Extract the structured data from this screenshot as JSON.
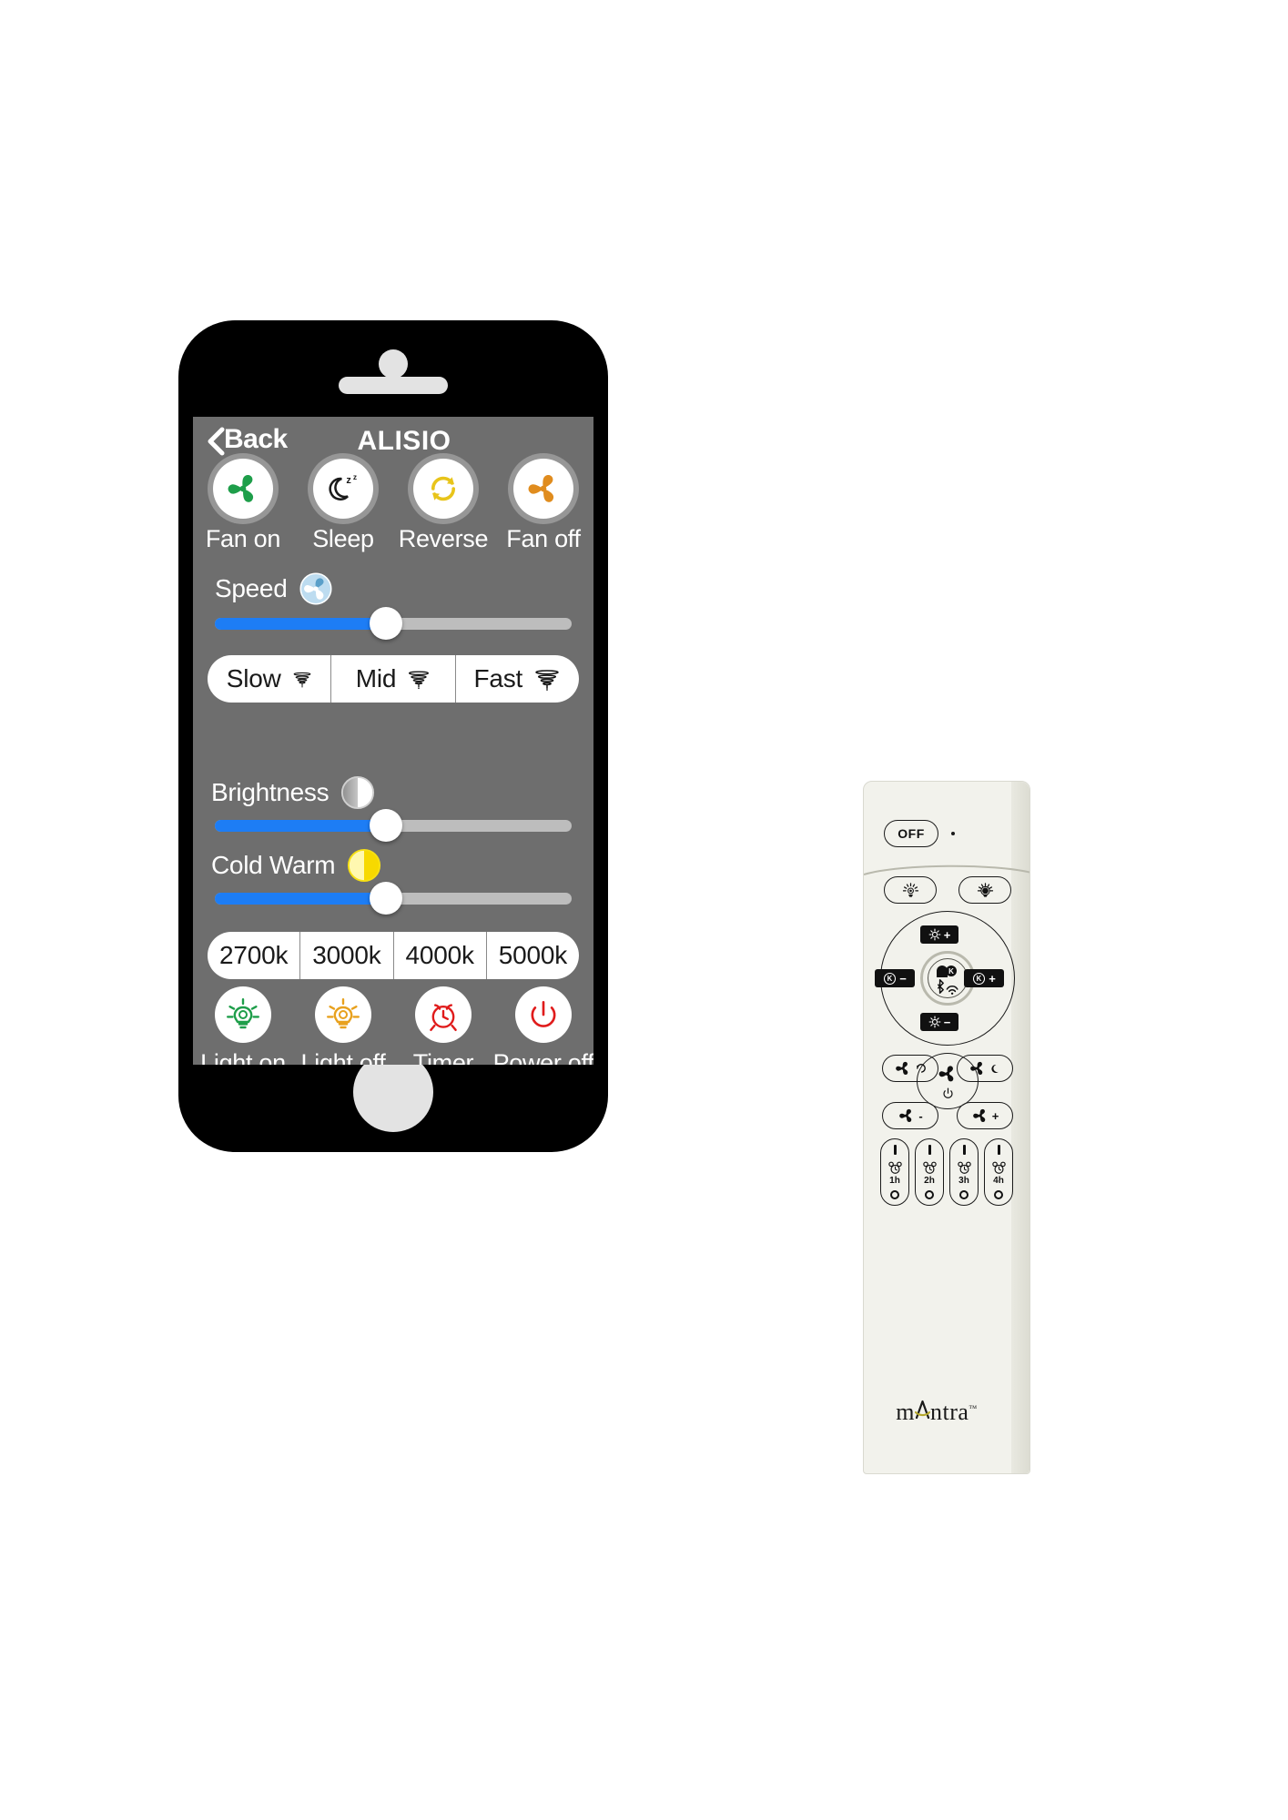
{
  "app": {
    "nav": {
      "back_label": "Back",
      "title": "ALISIO"
    },
    "fan_row": [
      {
        "label": "Fan on",
        "icon": "fan-icon",
        "color": "#1e9e4a"
      },
      {
        "label": "Sleep",
        "icon": "moon-zzz-icon",
        "color": "#1a1a1a"
      },
      {
        "label": "Reverse",
        "icon": "reverse-arrows-icon",
        "color": "#e8c41a"
      },
      {
        "label": "Fan off",
        "icon": "fan-icon",
        "color": "#e08c1e"
      }
    ],
    "speed": {
      "label": "Speed",
      "badge_icon": "fan-badge-icon",
      "badge_color": "#bddcf0",
      "value_percent": 48,
      "fill_color": "#1d7df5",
      "track_color": "#bdbdbd"
    },
    "speed_presets": [
      {
        "label": "Slow",
        "icon": "tornado-small-icon"
      },
      {
        "label": "Mid",
        "icon": "tornado-medium-icon"
      },
      {
        "label": "Fast",
        "icon": "tornado-large-icon"
      }
    ],
    "brightness": {
      "label": "Brightness",
      "badge_icon": "half-circle-icon",
      "badge_color": "#ffffff",
      "value_percent": 48,
      "fill_color": "#1d7df5",
      "track_color": "#bdbdbd"
    },
    "cold_warm": {
      "label": "Cold Warm",
      "badge_icon": "half-circle-warm-icon",
      "badge_color": "#f7e013",
      "value_percent": 48,
      "fill_color": "#1d7df5",
      "track_color": "#bdbdbd"
    },
    "kelvin_presets": [
      {
        "label": "2700k"
      },
      {
        "label": "3000k"
      },
      {
        "label": "4000k"
      },
      {
        "label": "5000k"
      }
    ],
    "light_row": [
      {
        "label": "Light on",
        "icon": "bulb-icon",
        "color": "#1e9e4a"
      },
      {
        "label": "Light off",
        "icon": "bulb-icon",
        "color": "#e8a11e"
      },
      {
        "label": "Timer",
        "icon": "alarm-clock-icon",
        "color": "#e01b1b"
      },
      {
        "label": "Power off",
        "icon": "power-icon",
        "color": "#e01b1b"
      }
    ],
    "screen_bg": "#6e6e6e",
    "body_color": "#000000"
  },
  "remote": {
    "brand": "mantra",
    "brand_tm": "™",
    "off_button": "OFF",
    "body_color": "#f2f2ec",
    "light_row_icons": [
      {
        "name": "light-on-icon"
      },
      {
        "name": "light-off-icon"
      }
    ],
    "dpad": {
      "up_label": "+",
      "up_icon": "sun-icon",
      "down_label": "−",
      "down_icon": "sun-icon",
      "left_label": "−",
      "left_icon": "kelvin-icon",
      "right_label": "+",
      "right_icon": "kelvin-icon",
      "center_icon": "bluetooth-wifi-icon"
    },
    "fan_buttons": [
      {
        "name": "fan-reverse-button",
        "icon": "fan-reverse-icon",
        "label": ""
      },
      {
        "name": "fan-sleep-button",
        "icon": "fan-moon-icon",
        "label": ""
      },
      {
        "name": "fan-minus-button",
        "icon": "fan-icon",
        "label": "-"
      },
      {
        "name": "fan-plus-button",
        "icon": "fan-icon",
        "label": "+"
      }
    ],
    "fan_power": {
      "icon": "fan-icon",
      "sub_icon": "power-icon"
    },
    "timers": [
      {
        "label": "1h"
      },
      {
        "label": "2h"
      },
      {
        "label": "3h"
      },
      {
        "label": "4h"
      }
    ]
  }
}
